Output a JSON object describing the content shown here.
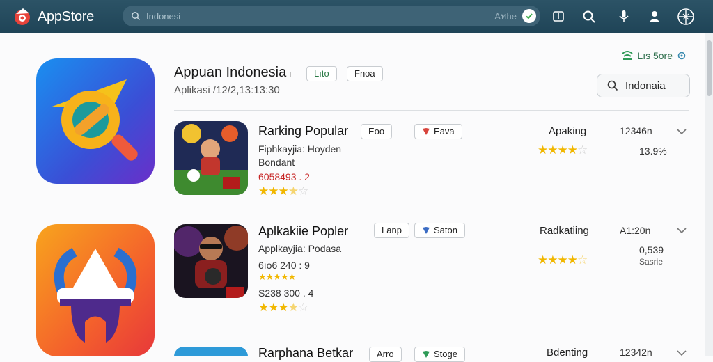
{
  "header": {
    "brand": "AppStore",
    "search_placeholder": "Indonesi",
    "search_right_text": "Aทhe",
    "icons": [
      "tablet-icon",
      "search-icon",
      "microphone-icon",
      "user-icon",
      "globe-icon"
    ]
  },
  "section": {
    "title": "Appuan Indonesia",
    "title_mark": "ı",
    "subtitle": "Aplikasi /12/2,13:13:30",
    "chip_1": "Lıto",
    "chip_2": "Fnoa",
    "live_store": "Lıs 5ore",
    "region_button": "Indonaia"
  },
  "apps": [
    {
      "title": "Rarking Popular",
      "chip_1": "Eoo",
      "chip_2": "Eava",
      "line_1": "Fiphkayjia: Hoyden",
      "line_2": "Bondant",
      "price": "6058493 . 2",
      "price_color": "#c72424",
      "row_rating": 3.5,
      "rank_label": "Apaking",
      "rank_value": "12346n",
      "rank_sub": "13.9%",
      "rank_rating": 4.5
    },
    {
      "title": "Aplkakiie Popler",
      "chip_1": "Lanp",
      "chip_2": "Saton",
      "line_1": "Applkayjia: Podasa",
      "line_2": "6ıo6 240 : 9",
      "line_2b": "S238 300 . 4",
      "row_rating_mid": 5,
      "row_rating": 3.5,
      "rank_label": "Radkatiing",
      "rank_value": "A1:20n",
      "rank_sub": "0,539",
      "rank_sub2": "Sasrie",
      "rank_rating": 4.5
    },
    {
      "title": "Rarphana Betkar",
      "chip_1": "Arro",
      "chip_2": "Stoge",
      "rank_label": "Bdenting",
      "rank_value": "12342n"
    }
  ],
  "colors": {
    "topbar": "#24495c",
    "star": "#f1b700",
    "price_red": "#c72424",
    "live_green": "#2f6f4d"
  }
}
